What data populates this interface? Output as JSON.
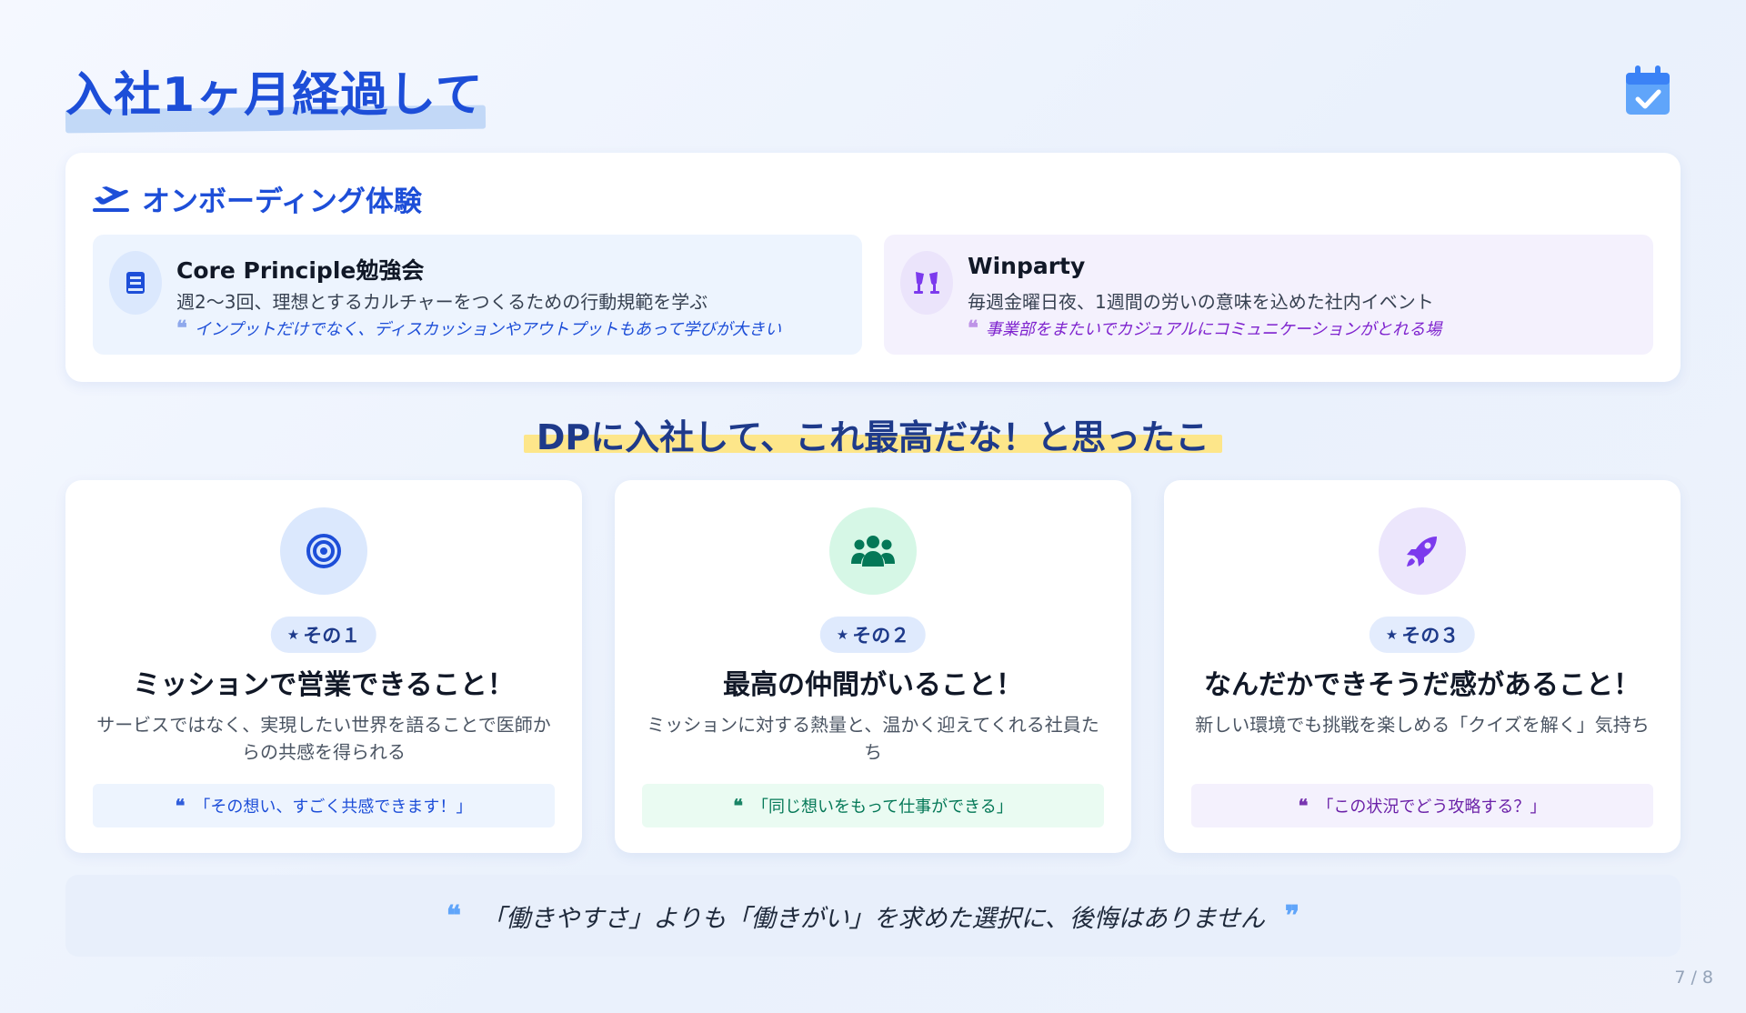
{
  "page": {
    "title": "入社1ヶ月経過して",
    "page_number": "7 / 8"
  },
  "onboarding": {
    "title": "オンボーディング体験",
    "items": [
      {
        "name": "Core Principle勉強会",
        "description": "週2〜3回、理想とするカルチャーをつくるための行動規範を学ぶ",
        "quote": "インプットだけでなく、ディスカッションやアウトプットもあって学びが大きい",
        "icon": "book-icon"
      },
      {
        "name": "Winparty",
        "description": "毎週金曜日夜、1週間の労いの意味を込めた社内イベント",
        "quote": "事業部をまたいでカジュアルにコミュニケーションがとれる場",
        "icon": "toast-glasses-icon"
      }
    ]
  },
  "highlights": {
    "heading": "DPに入社して、これ最高だな！と思ったこと",
    "points": [
      {
        "badge": "その１",
        "title": "ミッションで営業できること！",
        "description": "サービスではなく、実現したい世界を語ることで医師からの共感を得られる",
        "quote": "「その想い、すごく共感できます！」",
        "icon": "target-icon"
      },
      {
        "badge": "その２",
        "title": "最高の仲間がいること！",
        "description": "ミッションに対する熱量と、温かく迎えてくれる社員たち",
        "quote": "「同じ想いをもって仕事ができる」",
        "icon": "users-icon"
      },
      {
        "badge": "その３",
        "title": "なんだかできそうだ感があること！",
        "description": "新しい環境でも挑戦を楽しめる「クイズを解く」気持ち",
        "quote": "「この状況でどう攻略する？」",
        "icon": "rocket-icon"
      }
    ]
  },
  "closing": {
    "text": "「働きやすさ」よりも「働きがい」を求めた選択に、後悔はありません"
  },
  "colors": {
    "primary": "#1d4ed8",
    "highlight_yellow": "#fde68a",
    "highlight_blue": "#bcd5f6",
    "green": "#059669",
    "purple": "#7c3aed"
  }
}
